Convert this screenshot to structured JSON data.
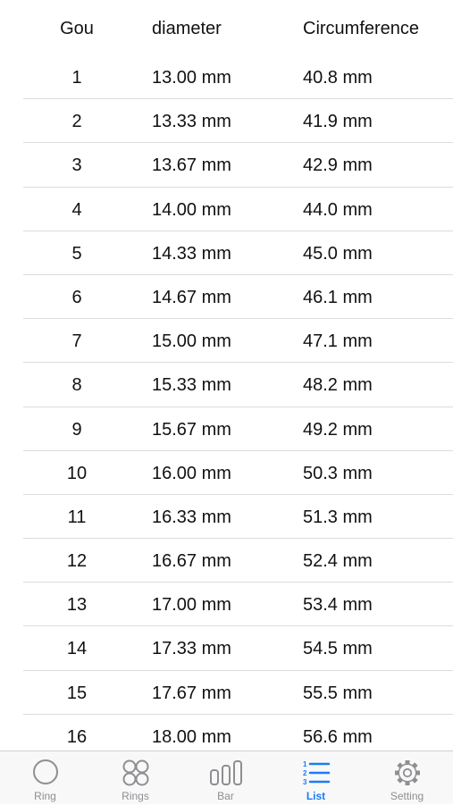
{
  "table": {
    "columns": [
      "Gou",
      "diameter",
      "Circumference"
    ],
    "rows": [
      [
        "1",
        "13.00 mm",
        "40.8 mm"
      ],
      [
        "2",
        "13.33 mm",
        "41.9 mm"
      ],
      [
        "3",
        "13.67 mm",
        "42.9 mm"
      ],
      [
        "4",
        "14.00 mm",
        "44.0 mm"
      ],
      [
        "5",
        "14.33 mm",
        "45.0 mm"
      ],
      [
        "6",
        "14.67 mm",
        "46.1 mm"
      ],
      [
        "7",
        "15.00 mm",
        "47.1 mm"
      ],
      [
        "8",
        "15.33 mm",
        "48.2 mm"
      ],
      [
        "9",
        "15.67 mm",
        "49.2 mm"
      ],
      [
        "10",
        "16.00 mm",
        "50.3 mm"
      ],
      [
        "11",
        "16.33 mm",
        "51.3 mm"
      ],
      [
        "12",
        "16.67 mm",
        "52.4 mm"
      ],
      [
        "13",
        "17.00 mm",
        "53.4 mm"
      ],
      [
        "14",
        "17.33 mm",
        "54.5 mm"
      ],
      [
        "15",
        "17.67 mm",
        "55.5 mm"
      ],
      [
        "16",
        "18.00 mm",
        "56.6 mm"
      ]
    ]
  },
  "tabbar": {
    "active_tab": "List",
    "tabs": [
      {
        "label": "Ring",
        "icon": "circle-icon"
      },
      {
        "label": "Rings",
        "icon": "four-circles-icon"
      },
      {
        "label": "Bar",
        "icon": "bars-icon"
      },
      {
        "label": "List",
        "icon": "numbered-list-icon"
      },
      {
        "label": "Setting",
        "icon": "gear-icon"
      }
    ]
  },
  "colors": {
    "accent": "#1a7cf5",
    "inactive": "#8e8e93",
    "separator": "#dcdcdc",
    "tabbar_bg": "#f8f8f8"
  }
}
